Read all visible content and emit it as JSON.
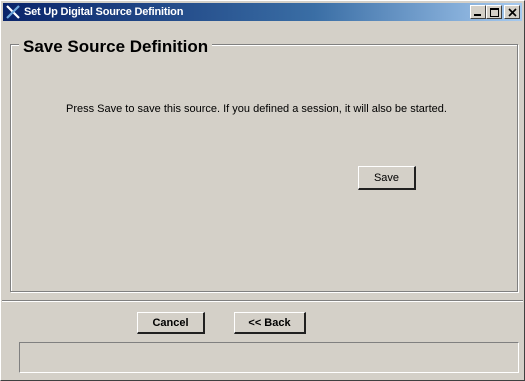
{
  "window": {
    "title": "Set Up Digital Source Definition",
    "icon": "x-logo-icon",
    "controls": [
      "minimize-icon",
      "maximize-icon",
      "close-icon"
    ]
  },
  "group": {
    "title": "Save Source Definition"
  },
  "message": {
    "text": "Press Save to save this source.  If you defined a session, it will also be started."
  },
  "buttons": {
    "save": "Save",
    "cancel": "Cancel",
    "back": "<< Back"
  },
  "status_bar": {
    "text": ""
  },
  "colors": {
    "title_bar": "#0a246a",
    "face": "#d4d0c8"
  }
}
